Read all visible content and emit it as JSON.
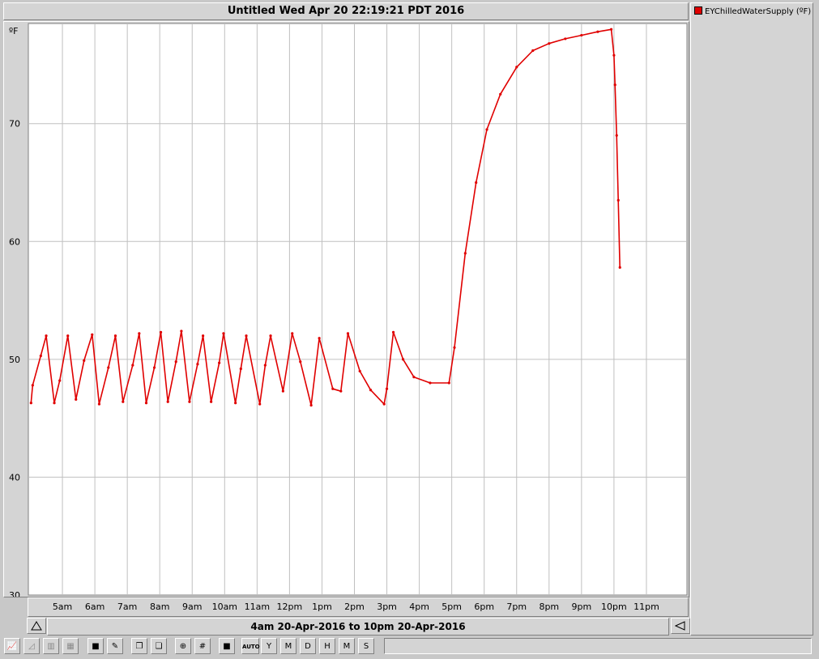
{
  "window": {
    "title": "Untitled Wed Apr 20 22:19:21 PDT 2016"
  },
  "legend": {
    "entries": [
      {
        "label": "EYChilledWaterSupply (ºF)",
        "color": "#e00000"
      }
    ]
  },
  "range_bar": {
    "label": "4am 20-Apr-2016 to 10pm 20-Apr-2016",
    "left_icon": "triangle-up-icon",
    "right_icon": "triangle-left-icon"
  },
  "toolbar": {
    "buttons": [
      {
        "name": "line-chart-icon",
        "glyph": "📈"
      },
      {
        "name": "area-chart-icon",
        "glyph": "◿"
      },
      {
        "name": "bar-chart-icon",
        "glyph": "▥"
      },
      {
        "name": "table-icon",
        "glyph": "▦"
      },
      {
        "name": "3d-box-icon",
        "glyph": "■"
      },
      {
        "name": "brush-icon",
        "glyph": "✎"
      },
      {
        "name": "copy-icon",
        "glyph": "❐"
      },
      {
        "name": "paste-icon",
        "glyph": "❏"
      },
      {
        "name": "zoom-icon",
        "glyph": "⊕"
      },
      {
        "name": "grid-icon",
        "glyph": "#"
      },
      {
        "name": "save-icon",
        "glyph": "■"
      },
      {
        "name": "auto-button",
        "glyph": "AUTO"
      },
      {
        "name": "year-button",
        "glyph": "Y"
      },
      {
        "name": "month-button",
        "glyph": "M"
      },
      {
        "name": "day-button",
        "glyph": "D"
      },
      {
        "name": "hour-button",
        "glyph": "H"
      },
      {
        "name": "minute-button",
        "glyph": "M"
      },
      {
        "name": "second-button",
        "glyph": "S"
      }
    ]
  },
  "chart_data": {
    "type": "line",
    "title": "Untitled Wed Apr 20 22:19:21 PDT 2016",
    "ylabel": "ºF",
    "xlabel": "",
    "ylim": [
      30,
      78.5
    ],
    "yticks": [
      30,
      40,
      50,
      60,
      70
    ],
    "xlim": [
      "2016-04-20 04:00",
      "2016-04-20 22:00"
    ],
    "xtick_labels": [
      "5am",
      "6am",
      "7am",
      "8am",
      "9am",
      "10am",
      "11am",
      "12pm",
      "1pm",
      "2pm",
      "3pm",
      "4pm",
      "5pm",
      "6pm",
      "7pm",
      "8pm",
      "9pm",
      "10pm",
      "11pm"
    ],
    "grid": true,
    "legend_position": "right-panel",
    "series": [
      {
        "name": "EYChilledWaterSupply (ºF)",
        "color": "#e00000",
        "points": [
          [
            "2016-04-20 04:02",
            46.3
          ],
          [
            "2016-04-20 04:05",
            47.8
          ],
          [
            "2016-04-20 04:20",
            50.3
          ],
          [
            "2016-04-20 04:30",
            52.0
          ],
          [
            "2016-04-20 04:45",
            46.3
          ],
          [
            "2016-04-20 04:55",
            48.2
          ],
          [
            "2016-04-20 05:10",
            52.0
          ],
          [
            "2016-04-20 05:25",
            46.6
          ],
          [
            "2016-04-20 05:40",
            49.9
          ],
          [
            "2016-04-20 05:55",
            52.1
          ],
          [
            "2016-04-20 06:08",
            46.2
          ],
          [
            "2016-04-20 06:25",
            49.3
          ],
          [
            "2016-04-20 06:38",
            52.0
          ],
          [
            "2016-04-20 06:52",
            46.4
          ],
          [
            "2016-04-20 07:10",
            49.5
          ],
          [
            "2016-04-20 07:22",
            52.2
          ],
          [
            "2016-04-20 07:35",
            46.3
          ],
          [
            "2016-04-20 07:50",
            49.3
          ],
          [
            "2016-04-20 08:02",
            52.3
          ],
          [
            "2016-04-20 08:15",
            46.4
          ],
          [
            "2016-04-20 08:30",
            49.8
          ],
          [
            "2016-04-20 08:40",
            52.4
          ],
          [
            "2016-04-20 08:55",
            46.4
          ],
          [
            "2016-04-20 09:10",
            49.6
          ],
          [
            "2016-04-20 09:20",
            52.0
          ],
          [
            "2016-04-20 09:35",
            46.4
          ],
          [
            "2016-04-20 09:50",
            49.7
          ],
          [
            "2016-04-20 09:58",
            52.2
          ],
          [
            "2016-04-20 10:20",
            46.3
          ],
          [
            "2016-04-20 10:30",
            49.2
          ],
          [
            "2016-04-20 10:40",
            52.0
          ],
          [
            "2016-04-20 11:05",
            46.2
          ],
          [
            "2016-04-20 11:15",
            49.5
          ],
          [
            "2016-04-20 11:25",
            52.0
          ],
          [
            "2016-04-20 11:48",
            47.3
          ],
          [
            "2016-04-20 12:05",
            52.2
          ],
          [
            "2016-04-20 12:20",
            49.8
          ],
          [
            "2016-04-20 12:40",
            46.1
          ],
          [
            "2016-04-20 12:55",
            51.8
          ],
          [
            "2016-04-20 13:20",
            47.5
          ],
          [
            "2016-04-20 13:35",
            47.3
          ],
          [
            "2016-04-20 13:48",
            52.2
          ],
          [
            "2016-04-20 14:10",
            49.0
          ],
          [
            "2016-04-20 14:30",
            47.4
          ],
          [
            "2016-04-20 14:55",
            46.2
          ],
          [
            "2016-04-20 15:00",
            47.5
          ],
          [
            "2016-04-20 15:12",
            52.3
          ],
          [
            "2016-04-20 15:30",
            50.0
          ],
          [
            "2016-04-20 15:50",
            48.5
          ],
          [
            "2016-04-20 16:20",
            48.0
          ],
          [
            "2016-04-20 16:55",
            48.0
          ],
          [
            "2016-04-20 17:05",
            51.0
          ],
          [
            "2016-04-20 17:25",
            59.0
          ],
          [
            "2016-04-20 17:45",
            65.0
          ],
          [
            "2016-04-20 18:05",
            69.5
          ],
          [
            "2016-04-20 18:30",
            72.5
          ],
          [
            "2016-04-20 19:00",
            74.8
          ],
          [
            "2016-04-20 19:30",
            76.2
          ],
          [
            "2016-04-20 20:00",
            76.8
          ],
          [
            "2016-04-20 20:30",
            77.2
          ],
          [
            "2016-04-20 21:00",
            77.5
          ],
          [
            "2016-04-20 21:30",
            77.8
          ],
          [
            "2016-04-20 21:55",
            78.0
          ],
          [
            "2016-04-20 22:00",
            75.8
          ],
          [
            "2016-04-20 22:02",
            73.3
          ],
          [
            "2016-04-20 22:05",
            69.0
          ],
          [
            "2016-04-20 22:08",
            63.5
          ],
          [
            "2016-04-20 22:11",
            57.8
          ]
        ]
      }
    ]
  }
}
